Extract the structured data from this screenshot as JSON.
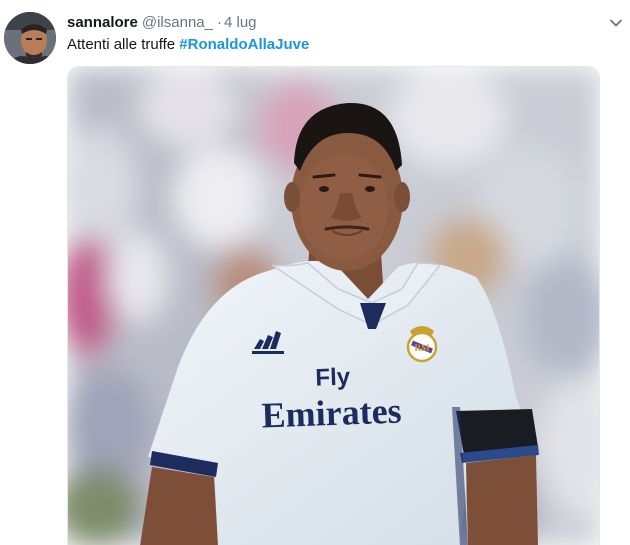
{
  "tweet": {
    "display_name": "sannalore",
    "handle": "@ilsanna_",
    "separator": "·",
    "timestamp": "4 lug",
    "text": "Attenti alle truffe ",
    "hashtag": "#RonaldoAllaJuve"
  },
  "photo": {
    "sponsor_line1": "Fly",
    "sponsor_line2": "Emirates"
  },
  "icons": {
    "avatar": "avatar",
    "menu": "chevron-down-icon",
    "brand_logo": "adidas-logo",
    "club_crest": "real-madrid-crest"
  },
  "colors": {
    "name": "#14171a",
    "muted": "#657786",
    "link": "#1b95e0",
    "jersey": "#e8eff5",
    "jersey_print": "#1c2c5e"
  }
}
